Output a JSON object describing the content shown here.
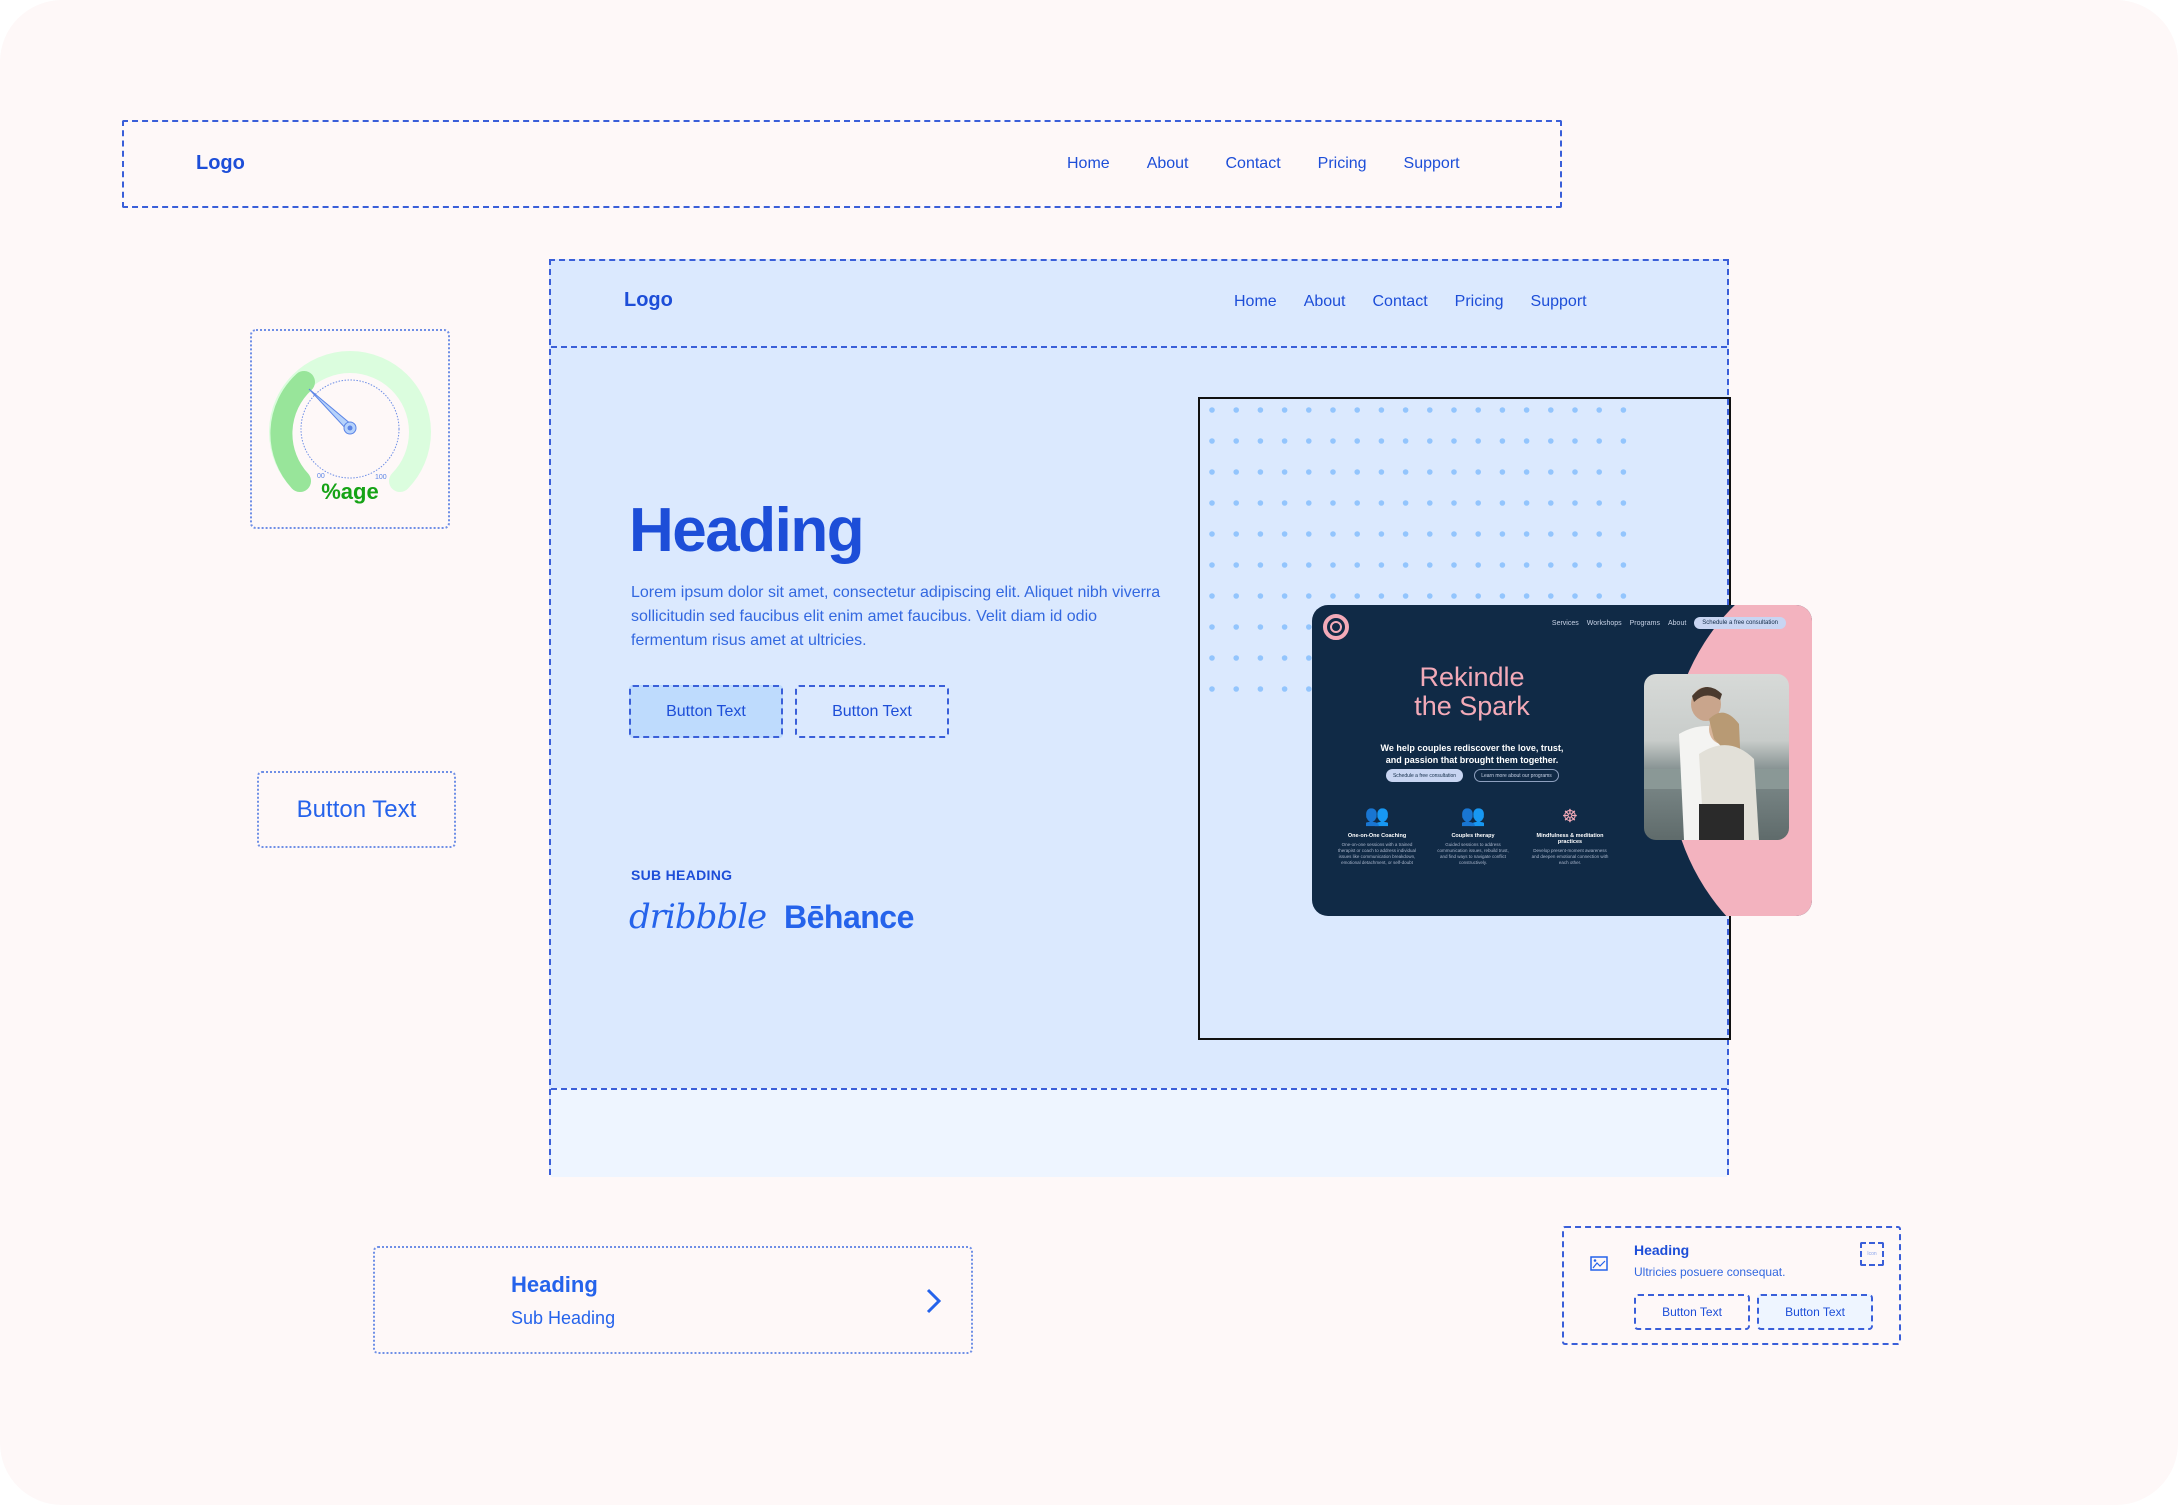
{
  "top_nav": {
    "logo": "Logo",
    "links": [
      "Home",
      "About",
      "Contact",
      "Pricing",
      "Support"
    ]
  },
  "gauge": {
    "min_label": "00",
    "max_label": "100",
    "label": "%age",
    "value_percent": 25,
    "colors": {
      "fill": "#98e59a",
      "track": "#dbfdde",
      "label": "#16a316",
      "needle": "#b6d2fb"
    }
  },
  "hero": {
    "nav": {
      "logo": "Logo",
      "links": [
        "Home",
        "About",
        "Contact",
        "Pricing",
        "Support"
      ]
    },
    "heading": "Heading",
    "paragraph": "Lorem ipsum dolor sit amet, consectetur adipiscing elit. Aliquet nibh viverra sollicitudin sed faucibus elit enim amet faucibus. Velit diam id odio fermentum risus amet at ultricies.",
    "primary_button": "Button Text",
    "secondary_button": "Button Text",
    "sub_heading": "SUB HEADING",
    "brands": [
      "dribbble",
      "Bēhance"
    ]
  },
  "mockup": {
    "nav_links": [
      "Services",
      "Workshops",
      "Programs",
      "About"
    ],
    "nav_cta": "Schedule a free consultation",
    "title_line1": "Rekindle",
    "title_line2": "the Spark",
    "subtitle_line1": "We help couples rediscover the love, trust,",
    "subtitle_line2": "and passion that brought them together.",
    "cta_primary": "Schedule a free consultation",
    "cta_secondary": "Learn more about our programs",
    "features": [
      {
        "icon": "coaching-icon",
        "title": "One-on-One Coaching",
        "desc": "One-on-one sessions with a trained therapist or coach to address individual issues like communication breakdown, emotional detachment, or self-doubt"
      },
      {
        "icon": "therapy-icon",
        "title": "Couples therapy",
        "desc": "Guided sessions to address communication issues, rebuild trust, and find ways to navigate conflict constructively."
      },
      {
        "icon": "meditation-icon",
        "title": "Mindfulness & meditation practices",
        "desc": "Develop present-moment awareness and deepen emotional connection with each other."
      }
    ],
    "colors": {
      "bg": "#102a46",
      "accent": "#f3b3bf"
    }
  },
  "standalone_button": {
    "label": "Button Text"
  },
  "list_card": {
    "heading": "Heading",
    "sub_heading": "Sub Heading"
  },
  "small_card": {
    "heading": "Heading",
    "description": "Ultricies posuere consequat.",
    "icon_placeholder": "Icon",
    "button1": "Button Text",
    "button2": "Button Text"
  },
  "colors": {
    "primary": "#1d4ed8",
    "hero_bg": "#dbe9fe",
    "page_bg": "#fef8f8",
    "dot": "#93c5fd"
  }
}
